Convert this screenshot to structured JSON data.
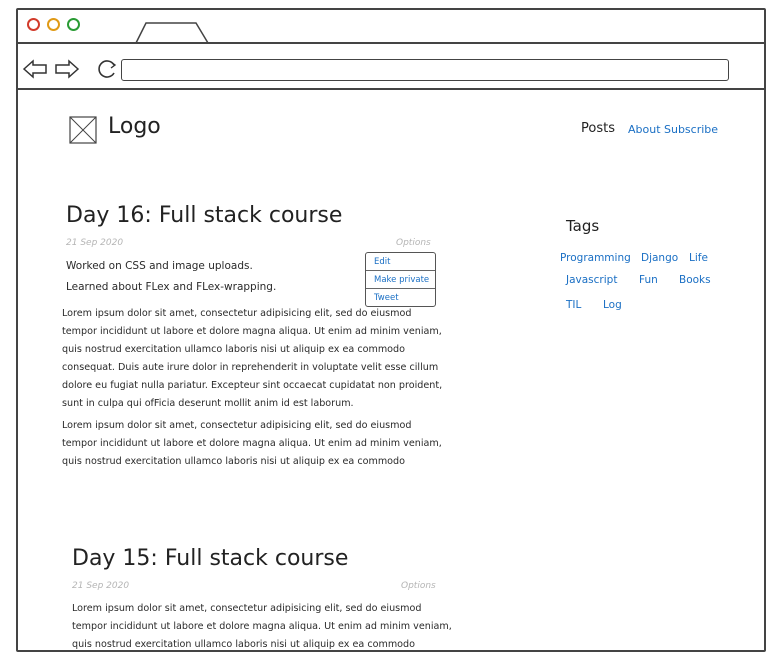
{
  "logo": {
    "text": "Logo"
  },
  "nav": {
    "posts": "Posts",
    "about": "About",
    "subscribe": "Subscribe"
  },
  "posts": [
    {
      "title": "Day 16: Full stack course",
      "date": "21 Sep 2020",
      "options": "Options",
      "lines": [
        "Worked on CSS and image uploads.",
        "Learned about FLex and FLex-wrapping."
      ],
      "paragraphs": [
        [
          "    Lorem ipsum dolor sit amet, consectetur adipisicing elit, sed do eiusmod",
          "tempor incididunt ut labore et dolore magna aliqua. Ut enim ad minim veniam,",
          "quis nostrud exercitation ullamco laboris nisi ut aliquip ex ea commodo",
          "consequat. Duis aute irure dolor in reprehenderit in voluptate velit esse cillum",
          "dolore eu fugiat nulla pariatur. Excepteur sint occaecat cupidatat non proident,",
          "sunt in culpa qui ofFicia deserunt mollit anim id est laborum."
        ],
        [
          "    Lorem ipsum dolor sit amet, consectetur adipisicing elit, sed do eiusmod",
          "tempor incididunt ut labore et dolore magna aliqua. Ut enim ad minim veniam,",
          "quis nostrud exercitation ullamco laboris nisi ut aliquip ex ea commodo"
        ]
      ]
    },
    {
      "title": "Day 15: Full stack course",
      "date": "21 Sep 2020",
      "options": "Options",
      "paragraphs": [
        [
          "    Lorem ipsum dolor sit amet, consectetur adipisicing elit, sed do eiusmod",
          "tempor incididunt ut labore et dolore magna aliqua. Ut enim ad minim veniam,",
          "quis nostrud exercitation ullamco laboris nisi ut aliquip ex ea commodo"
        ]
      ]
    }
  ],
  "options_menu": {
    "edit": "Edit",
    "make_private": "Make private",
    "tweet": "Tweet"
  },
  "tags": {
    "title": "Tags",
    "items": [
      "Programming",
      "Django",
      "Life",
      "Javascript",
      "Fun",
      "Books",
      "TIL",
      "Log"
    ]
  },
  "colors": {
    "link": "#1a6fc4",
    "muted": "#b5b5b5",
    "text": "#2a2a2a"
  }
}
